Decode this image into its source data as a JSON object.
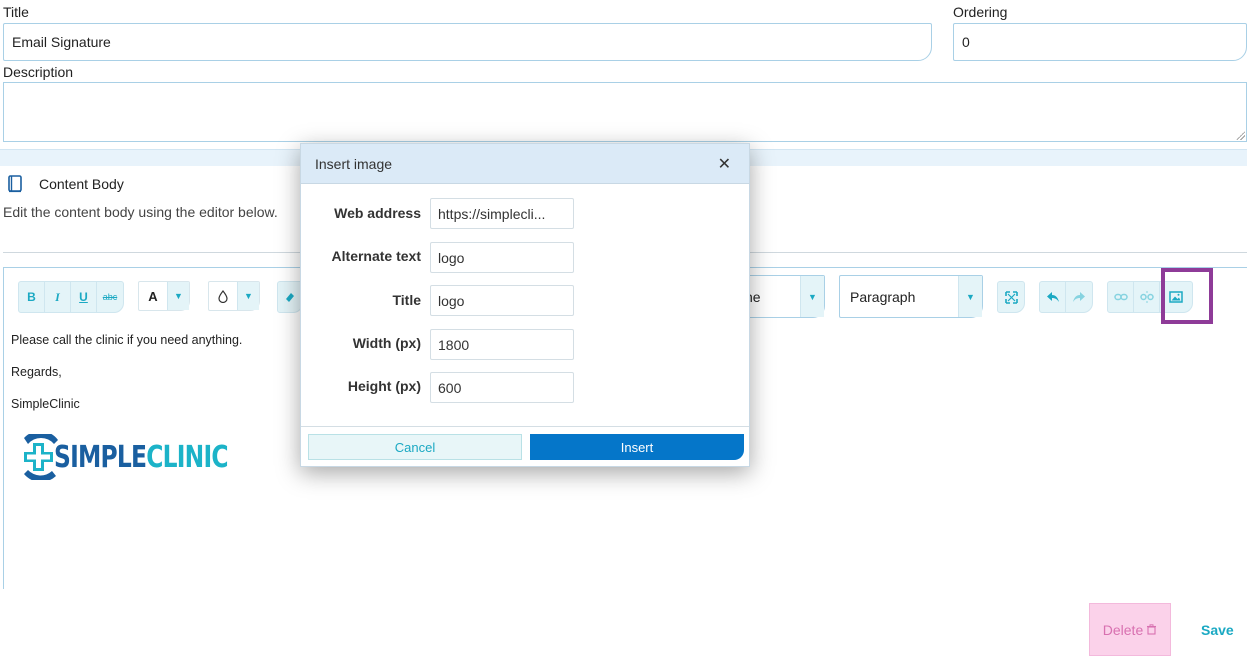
{
  "form": {
    "title_label": "Title",
    "title_value": "Email Signature",
    "ordering_label": "Ordering",
    "ordering_value": "0",
    "description_label": "Description",
    "description_value": ""
  },
  "content_section": {
    "heading": "Content Body",
    "hint": "Edit the content body using the editor below."
  },
  "toolbar": {
    "bold": "B",
    "italic": "I",
    "underline": "U",
    "strike": "abc",
    "font_color": "A",
    "font_partial": "ne",
    "format_value": "Paragraph"
  },
  "editor_content": {
    "line1": "Please call the clinic if you need anything.",
    "line2": "Regards,",
    "line3": "SimpleClinic",
    "logo_part1": "SIMPLE",
    "logo_part2": "CLINIC"
  },
  "modal": {
    "title": "Insert image",
    "close_glyph": "✕",
    "fields": {
      "web_address": {
        "label": "Web address",
        "value": "https://simplecli..."
      },
      "alternate_text": {
        "label": "Alternate text",
        "value": "logo"
      },
      "title": {
        "label": "Title",
        "value": "logo"
      },
      "width": {
        "label": "Width (px)",
        "value": "1800"
      },
      "height": {
        "label": "Height (px)",
        "value": "600"
      }
    },
    "cancel_label": "Cancel",
    "insert_label": "Insert"
  },
  "actions": {
    "delete_label": "Delete",
    "save_label": "Save"
  },
  "colors": {
    "accent": "#1ba9c3",
    "primary_button": "#0576c9",
    "highlight_box": "#8e3b98",
    "delete_bg": "#fbd2ea"
  }
}
